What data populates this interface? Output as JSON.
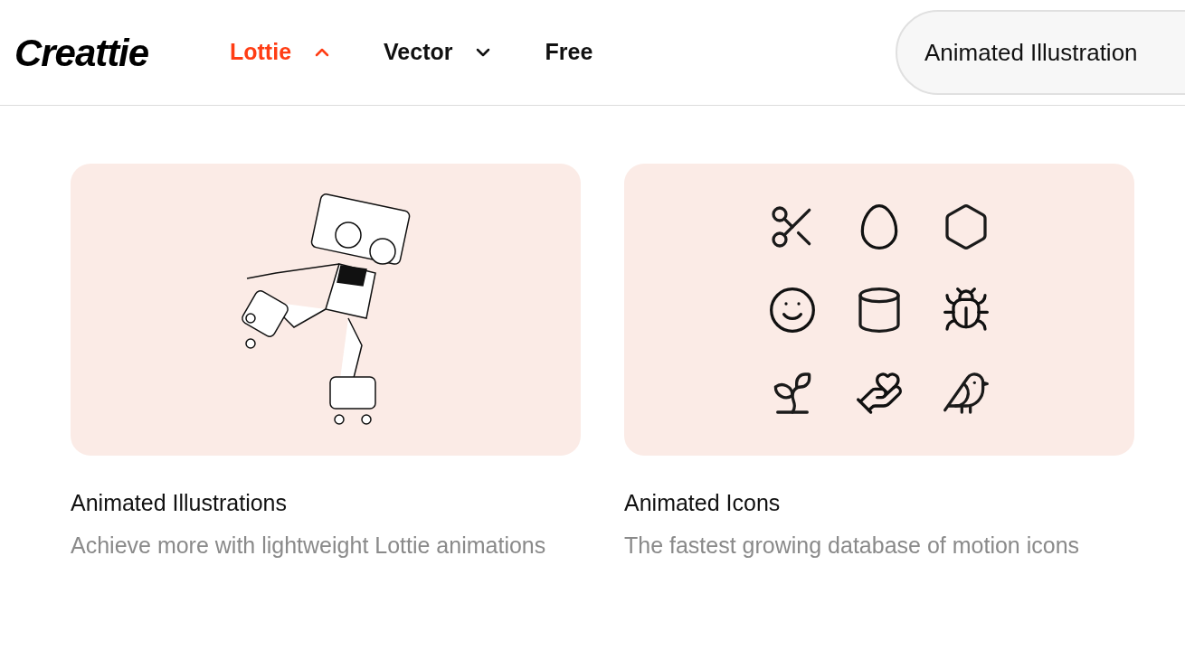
{
  "header": {
    "logo": "Creattie",
    "nav": [
      {
        "label": "Lottie",
        "kind": "dropdown",
        "expanded": true
      },
      {
        "label": "Vector",
        "kind": "dropdown",
        "expanded": false
      },
      {
        "label": "Free",
        "kind": "link",
        "expanded": false
      }
    ],
    "search": {
      "value": "Animated Illustration"
    }
  },
  "cards": [
    {
      "kind": "illustration",
      "title": "Animated Illustrations",
      "description": "Achieve more with lightweight Lottie animations"
    },
    {
      "kind": "icons",
      "title": "Animated Icons",
      "description": "The fastest growing database of motion icons"
    }
  ]
}
